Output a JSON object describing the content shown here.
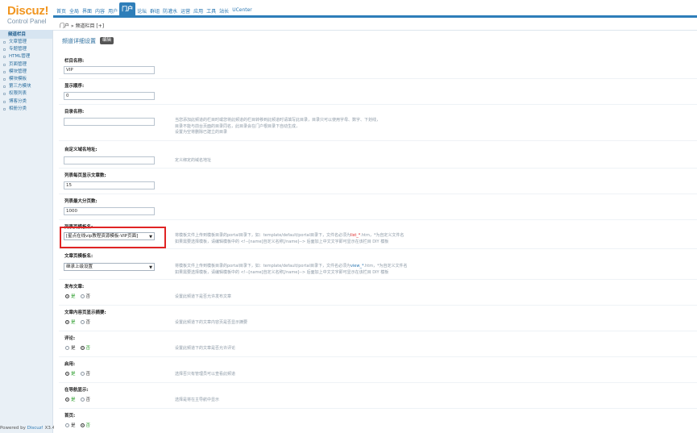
{
  "logo": {
    "title": "Discuz!",
    "subtitle": "Control Panel"
  },
  "topnav": [
    {
      "label": "首页",
      "active": false
    },
    {
      "label": "全局",
      "active": false
    },
    {
      "label": "界面",
      "active": false
    },
    {
      "label": "内容",
      "active": false
    },
    {
      "label": "用户",
      "active": false
    },
    {
      "label": "门户",
      "active": true
    },
    {
      "label": "论坛",
      "active": false
    },
    {
      "label": "群组",
      "active": false
    },
    {
      "label": "防灌水",
      "active": false
    },
    {
      "label": "运营",
      "active": false
    },
    {
      "label": "应用",
      "active": false
    },
    {
      "label": "工具",
      "active": false
    },
    {
      "label": "站长",
      "active": false
    },
    {
      "label": "UCenter",
      "active": false
    }
  ],
  "breadcrumb": "门户 » 频道栏目 [+]",
  "sidebar": {
    "items": [
      {
        "label": "频道栏目",
        "active": true
      },
      {
        "label": "文章管理",
        "active": false
      },
      {
        "label": "专题管理",
        "active": false
      },
      {
        "label": "HTML管理",
        "active": false
      },
      {
        "label": "页面管理",
        "active": false
      },
      {
        "label": "模块管理",
        "active": false
      },
      {
        "label": "模块模板",
        "active": false
      },
      {
        "label": "第三方模块",
        "active": false
      },
      {
        "label": "权限列表",
        "active": false
      },
      {
        "label": "博客分类",
        "active": false
      },
      {
        "label": "相册分类",
        "active": false
      }
    ]
  },
  "powered": {
    "prefix": "Powered by ",
    "brand": "Discuz!",
    "version": " X3.4"
  },
  "section": {
    "title": "频道详细设置",
    "edit_label": "编辑"
  },
  "form": {
    "channel_name": {
      "label": "栏目名称:",
      "value": "VIP"
    },
    "display_order": {
      "label": "显示顺序:",
      "value": "0"
    },
    "dir_name": {
      "label": "目录名称:",
      "value": "",
      "desc": [
        "当您添加此频道的栏目时或您将此频道的栏目转移到此频道时请填写此目录，目录只可以使用字母、数字、下划线，",
        "目录不能与前台页面的目录同名，此目录会在门户根目录下自动生成，",
        "设置为空将删除已建立的目录"
      ]
    },
    "custom_domain": {
      "label": "自定义域名地址:",
      "value": "",
      "desc": "定义绑定的域名地址"
    },
    "per_page": {
      "label": "列表每页显示文章数:",
      "value": "15"
    },
    "max_pages": {
      "label": "列表最大分页数:",
      "value": "1000"
    },
    "list_template": {
      "label": "列表页模板名:",
      "value": "[星点在线vip教程资源模板-VIP页面]",
      "desc": {
        "pre": "将模板文件上传到模板目录的portal目录下，如：template/default/portal目录下，文件名必须为",
        "em": "list_*",
        "post": ".htm，*为自定义文件名",
        "line2": "如果需要选择模板，请编辑模板中的 <!--[name]自定义名称[/name]--> 后面加上中文文字即可显示在该栏目 DIY 模板"
      }
    },
    "article_template": {
      "label": "文章页模板名:",
      "value": "继承上级设置",
      "desc": {
        "pre": "将模板文件上传到模板目录的portal目录下，如：template/default/portal目录下，文件名必须为",
        "em": "view_*",
        "post": ".htm，*为自定义文件名",
        "line2": "如果需要选择模板，请编辑模板中的 <!--[name]自定义名称[/name]--> 后面加上中文文字即可显示在该栏目 DIY 模板"
      }
    },
    "allow_publish": {
      "label": "发布文章:",
      "yes": "是",
      "no": "否",
      "selected": "yes",
      "desc": "设置此频道下是否允许发布文章"
    },
    "show_summary": {
      "label": "文章内容页显示摘要:",
      "yes": "是",
      "no": "否",
      "selected": "yes",
      "desc": "设置此频道下的文章内容页是否显示摘要"
    },
    "allow_comment": {
      "label": "评论:",
      "yes": "是",
      "no": "否",
      "selected": "no",
      "desc": "设置此频道下的文章是否允许评论"
    },
    "enabled": {
      "label": "启用:",
      "yes": "是",
      "no": "否",
      "selected": "yes",
      "desc": "选择否只有管理员可以查看此频道"
    },
    "in_nav": {
      "label": "在导航显示:",
      "yes": "是",
      "no": "否",
      "selected": "yes",
      "desc": "选择是将在主导航中显示"
    },
    "homepage": {
      "label": "首页:",
      "yes": "是",
      "no": "否",
      "selected": "no"
    }
  }
}
